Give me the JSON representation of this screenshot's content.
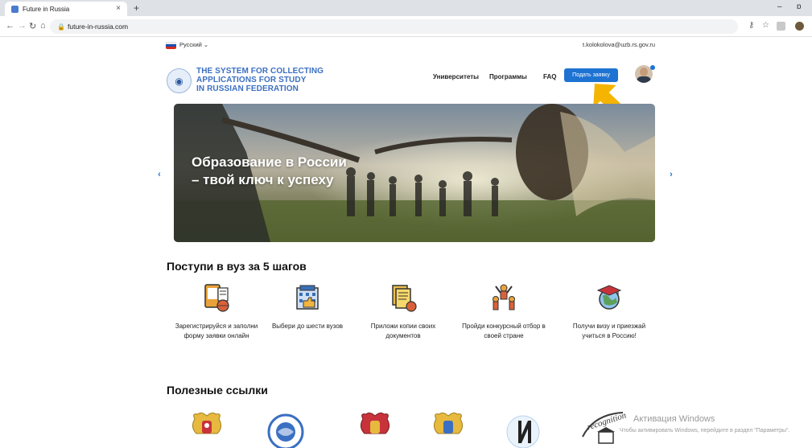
{
  "browser": {
    "tab_title": "Future in Russia",
    "tab_close": "×",
    "new_tab": "+",
    "url": "future-in-russia.com",
    "minimize": "–",
    "restore": "ɒ"
  },
  "topbar": {
    "language": "Русский ⌄",
    "email": "t.kolokolova@uzb.rs.gov.ru"
  },
  "logo": {
    "line1": "THE SYSTEM FOR COLLECTING",
    "line2": "APPLICATIONS FOR STUDY",
    "line3": "IN RUSSIAN FEDERATION"
  },
  "nav": {
    "universities": "Университеты",
    "programs": "Программы",
    "faq": "FAQ",
    "apply": "Подать заявку"
  },
  "hero": {
    "line1": "Образование в России",
    "line2": "– твой ключ к успеху",
    "prev": "‹",
    "next": "›"
  },
  "steps": {
    "title": "Поступи в вуз за 5 шагов",
    "items": [
      "Зарегистрируйся и заполни форму заявки онлайн",
      "Выбери до шести вузов",
      "Приложи копии своих документов",
      "Пройди конкурсный отбор в своей стране",
      "Получи визу и приезжай учиться в Россию!"
    ]
  },
  "links": {
    "title": "Полезные ссылки"
  },
  "watermark": {
    "line1": "Активация Windows",
    "line2": "Чтобы активировать Windows, перейдите в раздел \"Параметры\"."
  },
  "colors": {
    "primary": "#1e73d2",
    "accent_arrow": "#f5b400",
    "logo_blue": "#3b6fc2"
  }
}
